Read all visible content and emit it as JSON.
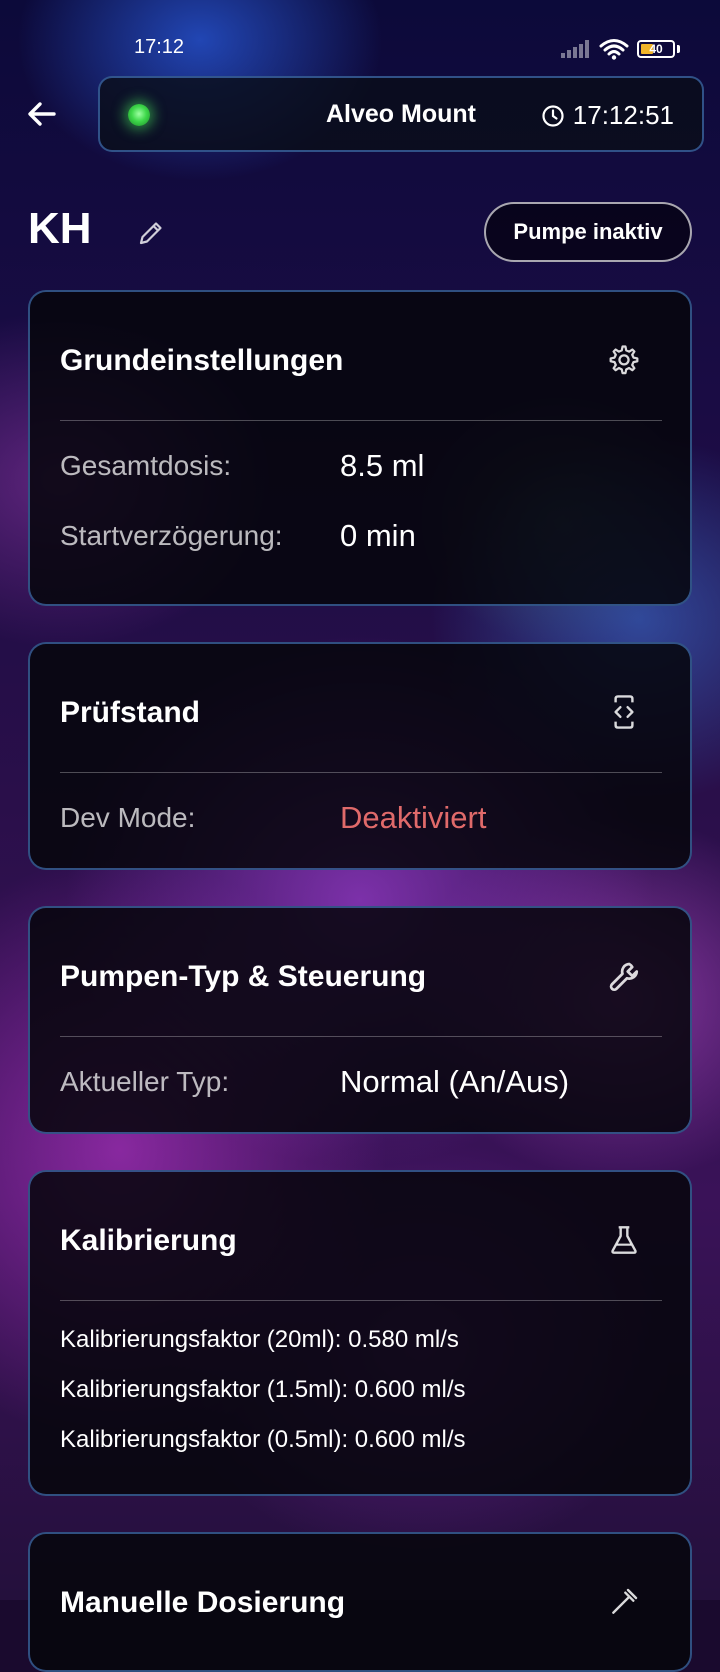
{
  "status_bar": {
    "time": "17:12",
    "battery": "40"
  },
  "header": {
    "device_name": "Alveo Mount",
    "clock": "17:12:51"
  },
  "title_row": {
    "title": "KH",
    "pump_button": "Pumpe inaktiv"
  },
  "cards": {
    "grundeinstellungen": {
      "title": "Grundeinstellungen",
      "rows": [
        {
          "label": "Gesamtdosis:",
          "value": "8.5 ml"
        },
        {
          "label": "Startverzögerung:",
          "value": "0 min"
        }
      ]
    },
    "pruefstand": {
      "title": "Prüfstand",
      "rows": [
        {
          "label": "Dev Mode:",
          "value": "Deaktiviert"
        }
      ]
    },
    "pumpentyp": {
      "title": "Pumpen-Typ & Steuerung",
      "rows": [
        {
          "label": "Aktueller Typ:",
          "value": "Normal (An/Aus)"
        }
      ]
    },
    "kalibrierung": {
      "title": "Kalibrierung",
      "lines": [
        "Kalibrierungsfaktor (20ml): 0.580 ml/s",
        "Kalibrierungsfaktor (1.5ml): 0.600 ml/s",
        "Kalibrierungsfaktor (0.5ml): 0.600 ml/s"
      ]
    },
    "manuell": {
      "title": "Manuelle Dosierung"
    }
  },
  "colors": {
    "accent_border": "#508cdc",
    "status_led": "#3ed84a",
    "alert_text": "#e06a6a",
    "battery_fill": "#f0b429"
  },
  "icons": [
    "back-arrow-icon",
    "clock-icon",
    "edit-pencil-icon",
    "gear-icon",
    "code-device-icon",
    "wrench-icon",
    "flask-icon",
    "dropper-icon",
    "signal-icon",
    "wifi-icon",
    "battery-icon"
  ]
}
